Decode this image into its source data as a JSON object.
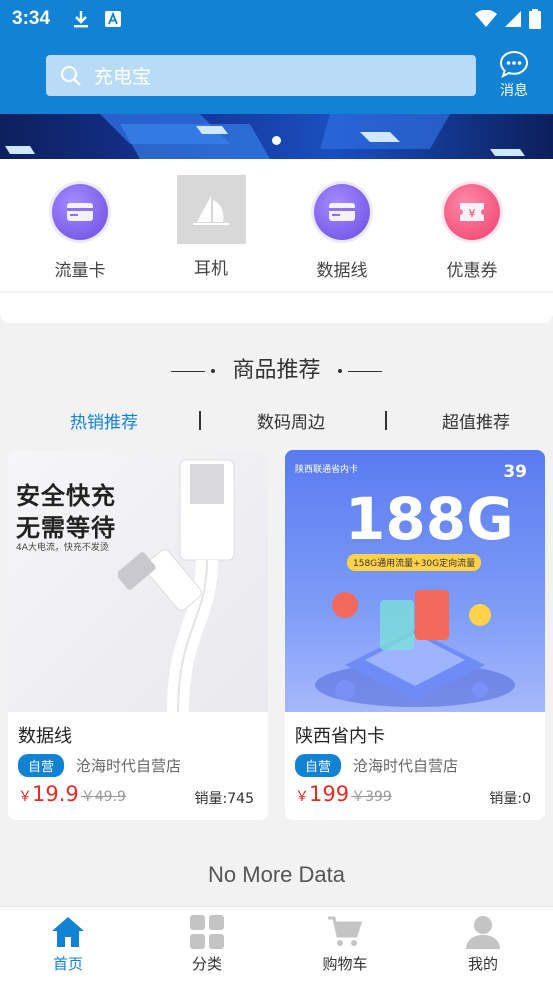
{
  "status_bar": {
    "time": "3:34"
  },
  "search": {
    "placeholder": "充电宝"
  },
  "header": {
    "message_label": "消息"
  },
  "categories": [
    {
      "label": "流量卡",
      "icon": "card-icon"
    },
    {
      "label": "耳机",
      "icon": "image-placeholder-icon"
    },
    {
      "label": "数据线",
      "icon": "card-icon"
    },
    {
      "label": "优惠券",
      "icon": "coupon-icon"
    }
  ],
  "section": {
    "title": "商品推荐"
  },
  "tabs": [
    {
      "label": "热销推荐",
      "active": true
    },
    {
      "label": "数码周边",
      "active": false
    },
    {
      "label": "超值推荐",
      "active": false
    }
  ],
  "products": [
    {
      "name": "数据线",
      "badge": "自营",
      "shop": "沧海时代自营店",
      "currency": "￥",
      "price": "19.9",
      "old_price": "￥49.9",
      "sales": "销量:745",
      "image_text": {
        "line1": "安全快充",
        "line2": "无需等待",
        "line3": "4A大电流，快充不发烫"
      }
    },
    {
      "name": "陕西省内卡",
      "badge": "自营",
      "shop": "沧海时代自营店",
      "currency": "￥",
      "price": "199",
      "old_price": "￥399",
      "sales": "销量:0",
      "image_text": {
        "top": "陕西联通省内卡",
        "big": "188G",
        "tag": "158G通用流量+30G定向流量",
        "price": "39"
      }
    }
  ],
  "footer_text": "No More Data",
  "tabbar": [
    {
      "label": "首页",
      "icon": "home-icon",
      "active": true
    },
    {
      "label": "分类",
      "icon": "grid-icon",
      "active": false
    },
    {
      "label": "购物车",
      "icon": "cart-icon",
      "active": false
    },
    {
      "label": "我的",
      "icon": "user-icon",
      "active": false
    }
  ],
  "colors": {
    "primary": "#1282d4",
    "price": "#e02e24",
    "background": "#f2f2f2"
  }
}
